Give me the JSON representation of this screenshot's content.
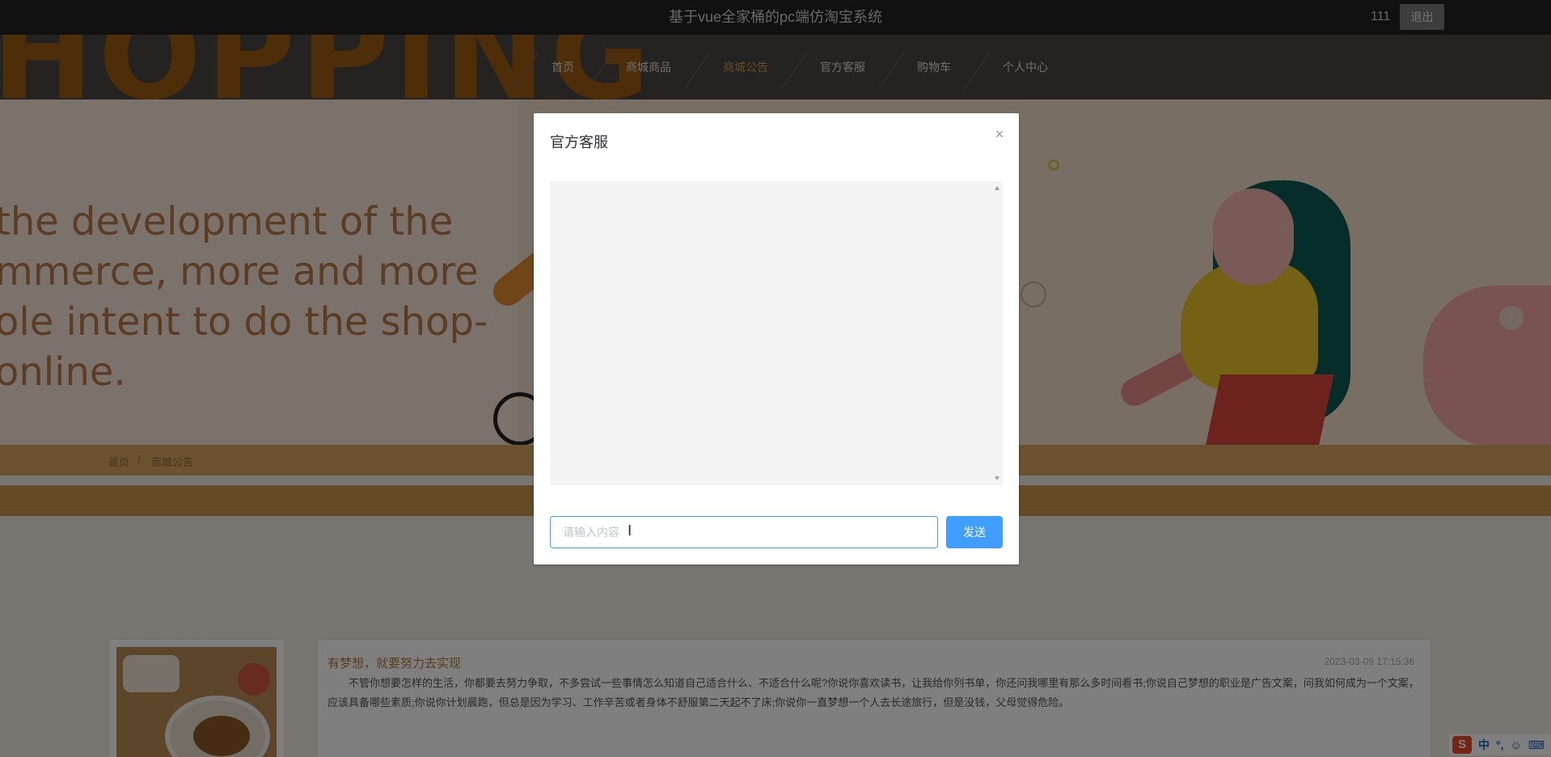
{
  "header": {
    "site_title": "基于vue全家桶的pc端仿淘宝系统",
    "username": "111",
    "logout_label": "退出"
  },
  "nav": {
    "decor_text": "HOPPING",
    "items": [
      {
        "label": "首页",
        "active": false
      },
      {
        "label": "商城商品",
        "active": false
      },
      {
        "label": "商城公告",
        "active": true
      },
      {
        "label": "官方客服",
        "active": false
      },
      {
        "label": "购物车",
        "active": false
      },
      {
        "label": "个人中心",
        "active": false
      }
    ]
  },
  "banner": {
    "lines": [
      "the development of the",
      "mmerce, more and more",
      "ole intent to do the shop-",
      " online."
    ],
    "next_arrow": "›"
  },
  "breadcrumb": {
    "home": "首页",
    "separator": "/",
    "current": "商城公告"
  },
  "article": {
    "title": "有梦想，就要努力去实现",
    "date": "2023-03-09 17:15:36",
    "body": "不管你想要怎样的生活，你都要去努力争取，不多尝试一些事情怎么知道自己适合什么、不适合什么呢?你说你喜欢读书，让我给你列书单，你还问我哪里有那么多时间看书;你说自己梦想的职业是广告文案，问我如何成为一个文案，应该具备哪些素质;你说你计划晨跑，但总是因为学习、工作辛苦或者身体不舒服第二天起不了床;你说你一直梦想一个人去长途旅行，但是没钱，父母觉得危险。"
  },
  "dialog": {
    "title": "官方客服",
    "close_icon": "×",
    "input": {
      "value": "",
      "placeholder": "请输入内容"
    },
    "send_label": "发送"
  },
  "ime": {
    "logo": "S",
    "mode": "中",
    "punct": "°,",
    "emoji": "☺",
    "keyboard": "⌨"
  },
  "colors": {
    "accent": "#409eff",
    "nav_active": "#c69a4a",
    "topbar": "#222222"
  }
}
